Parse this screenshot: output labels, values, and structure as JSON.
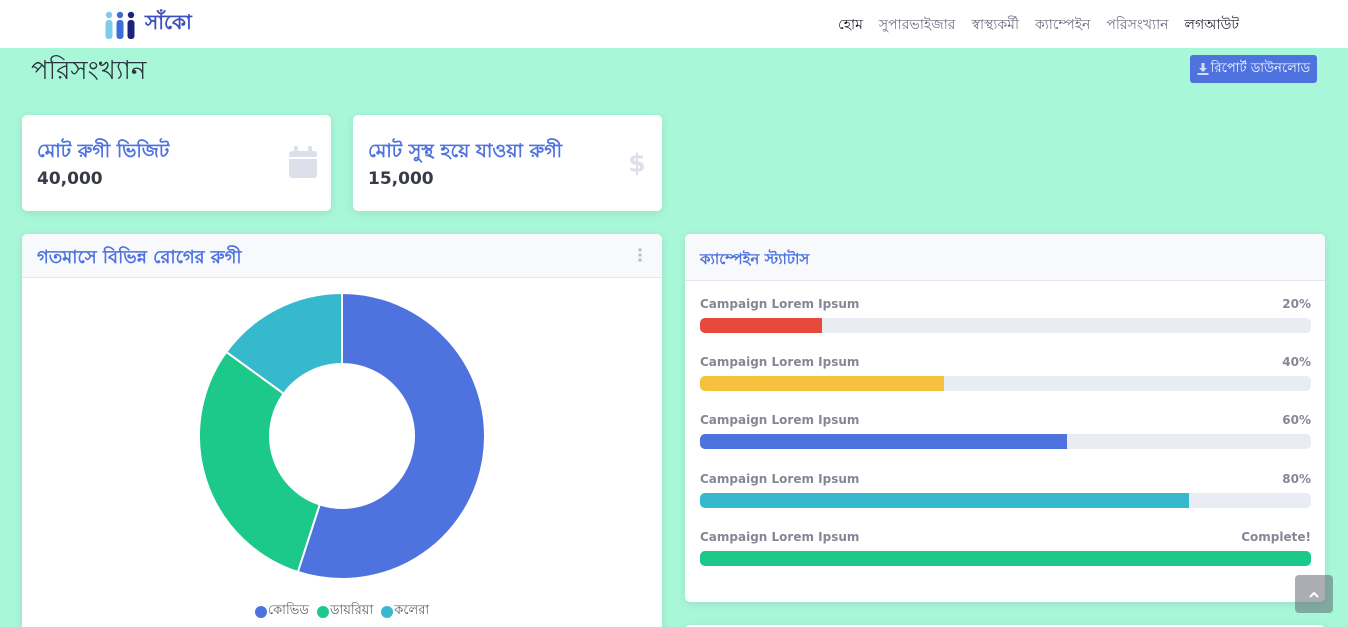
{
  "nav": {
    "brand": "সাঁকো",
    "links": [
      "হোম",
      "সুপারভাইজার",
      "স্বাস্থ্যকর্মী",
      "ক্যাম্পেইন",
      "পরিসংখ্যান",
      "লগআউট"
    ]
  },
  "page": {
    "title": "পরিসংখ্যান",
    "download_label": "রিপোর্ট ডাউনলোড"
  },
  "stats": [
    {
      "label": "মোট রুগী ভিজিট",
      "value": "40,000",
      "icon": "calendar-icon"
    },
    {
      "label": "মোট সুস্থ হয়ে যাওয়া রুগী",
      "value": "15,000",
      "icon": "dollar-icon"
    }
  ],
  "pie_card": {
    "title": "গতমাসে বিভিন্ন রোগের রুগী"
  },
  "chart_data": {
    "type": "pie",
    "labels": [
      "কোভিড",
      "ডায়রিয়া",
      "কলেরা"
    ],
    "values": [
      55,
      30,
      15
    ],
    "colors": [
      "#4e73df",
      "#1cc88a",
      "#36b9cc"
    ],
    "donut": true
  },
  "campaign_card": {
    "title": "ক্যাম্পেইন স্ট্যাটাস",
    "items": [
      {
        "name": "Campaign Lorem Ipsum",
        "label": "20%",
        "progress": 20,
        "color": "#e74a3b"
      },
      {
        "name": "Campaign Lorem Ipsum",
        "label": "40%",
        "progress": 40,
        "color": "#f6c23e"
      },
      {
        "name": "Campaign Lorem Ipsum",
        "label": "60%",
        "progress": 60,
        "color": "#4e73df"
      },
      {
        "name": "Campaign Lorem Ipsum",
        "label": "80%",
        "progress": 80,
        "color": "#36b9cc"
      },
      {
        "name": "Campaign Lorem Ipsum",
        "label": "Complete!",
        "progress": 100,
        "color": "#1cc88a"
      }
    ]
  }
}
